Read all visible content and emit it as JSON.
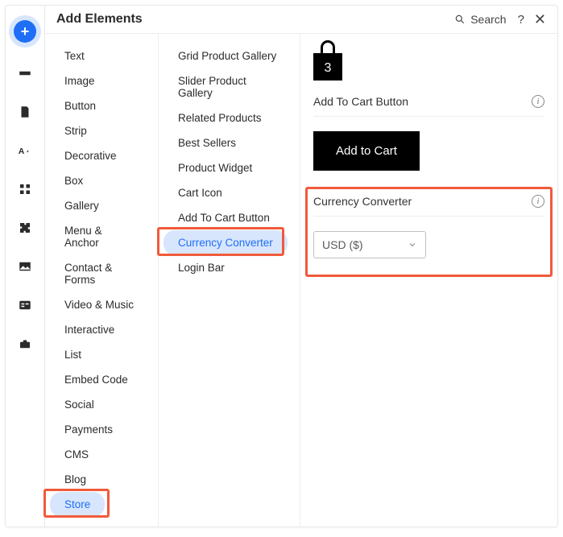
{
  "header": {
    "title": "Add Elements",
    "search_label": "Search"
  },
  "categories": [
    "Text",
    "Image",
    "Button",
    "Strip",
    "Decorative",
    "Box",
    "Gallery",
    "Menu & Anchor",
    "Contact & Forms",
    "Video & Music",
    "Interactive",
    "List",
    "Embed Code",
    "Social",
    "Payments",
    "CMS",
    "Blog",
    "Store"
  ],
  "categories_selected": "Store",
  "subitems": [
    "Grid Product Gallery",
    "Slider Product Gallery",
    "Related Products",
    "Best Sellers",
    "Product Widget",
    "Cart Icon",
    "Add To Cart Button",
    "Currency Converter",
    "Login Bar"
  ],
  "subitems_selected": "Currency Converter",
  "preview": {
    "bag_count": "3",
    "atc_heading": "Add To Cart Button",
    "atc_button": "Add to Cart",
    "cc_heading": "Currency Converter",
    "cc_value": "USD ($)"
  }
}
